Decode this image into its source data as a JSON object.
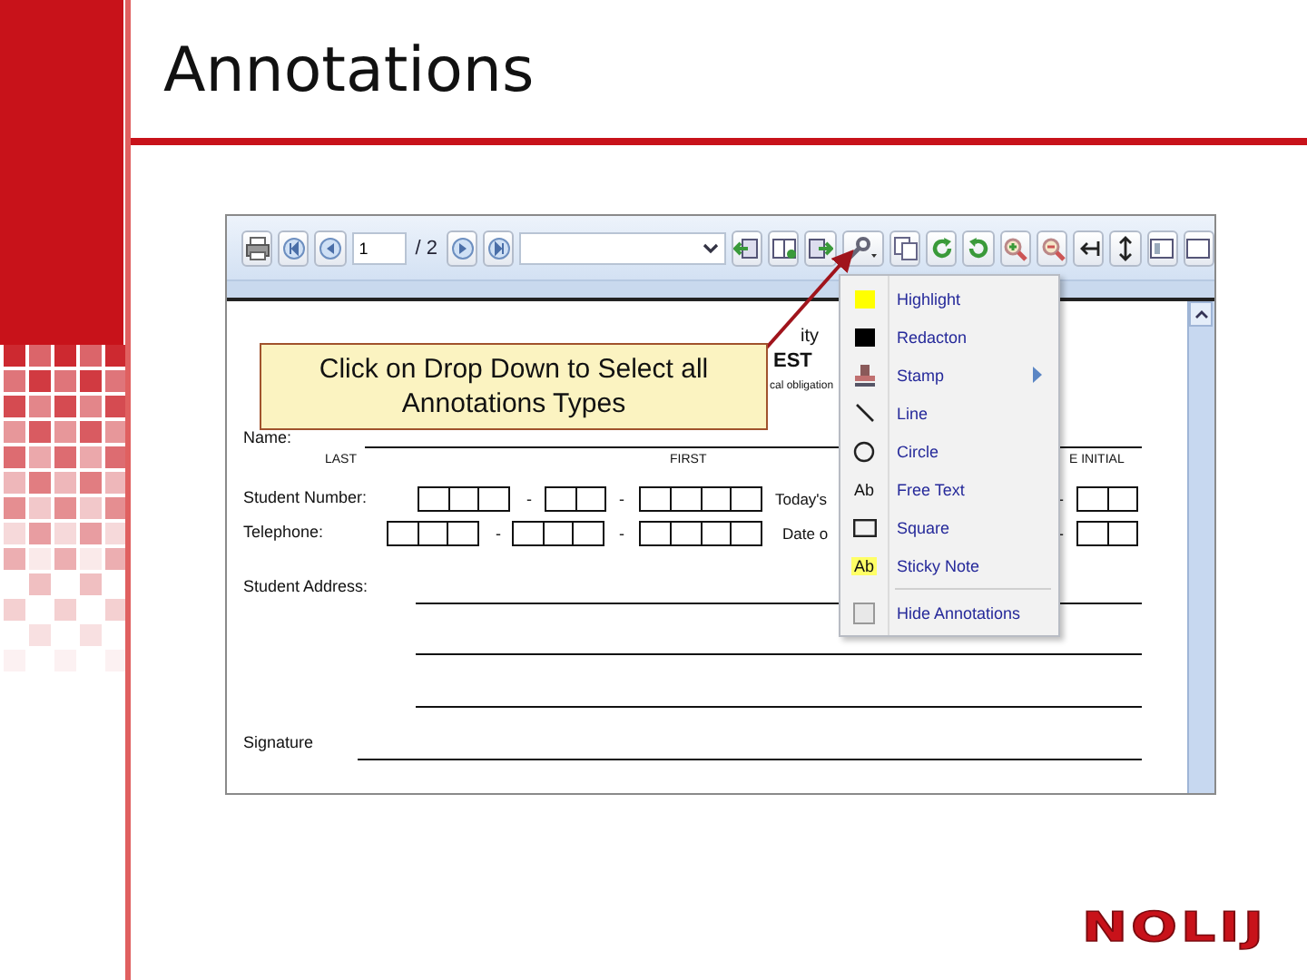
{
  "slide": {
    "title": "Annotations",
    "logo": "NOLIJ"
  },
  "toolbar": {
    "page_input": "1",
    "page_total": "/ 2"
  },
  "document": {
    "header_fragments": [
      "ity",
      "EST",
      "cal obligation"
    ],
    "name_label": "Name:",
    "name_parts": [
      "LAST",
      "FIRST",
      "E INITIAL"
    ],
    "rows": [
      {
        "label": "Student Number:",
        "separators": [
          "-",
          "-",
          "-"
        ],
        "side_label": "Today's"
      },
      {
        "label": "Telephone:",
        "separators": [
          "-",
          "-",
          "-"
        ],
        "side_label": "Date o"
      }
    ],
    "address_label": "Student Address:",
    "signature_label": "Signature"
  },
  "callout": "Click on Drop Down to Select all Annotations Types",
  "annotation_menu": [
    {
      "label": "Highlight",
      "kind": "highlight",
      "has_submenu": false
    },
    {
      "label": "Redacton",
      "kind": "redaction",
      "has_submenu": false
    },
    {
      "label": "Stamp",
      "kind": "stamp",
      "has_submenu": true
    },
    {
      "label": "Line",
      "kind": "line",
      "has_submenu": false
    },
    {
      "label": "Circle",
      "kind": "circle",
      "has_submenu": false
    },
    {
      "label": "Free Text",
      "kind": "freetext",
      "icon_text": "Ab",
      "has_submenu": false
    },
    {
      "label": "Square",
      "kind": "square",
      "has_submenu": false
    },
    {
      "label": "Sticky Note",
      "kind": "sticky",
      "icon_text": "Ab",
      "has_submenu": false
    },
    {
      "label": "Hide Annotations",
      "kind": "checkbox",
      "checked": false,
      "has_submenu": false
    }
  ]
}
